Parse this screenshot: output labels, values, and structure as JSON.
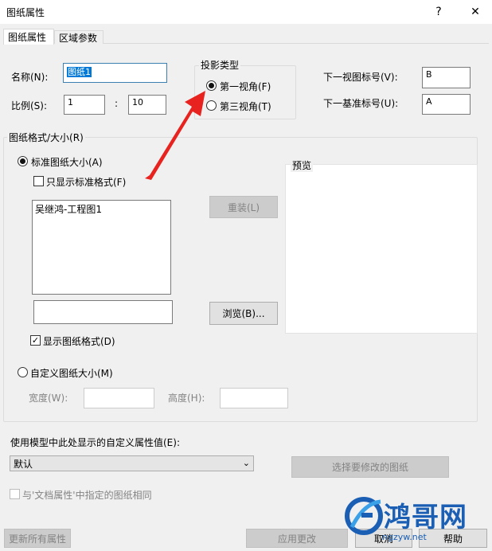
{
  "window": {
    "title": "图纸属性",
    "help_glyph": "?",
    "close_glyph": "✕"
  },
  "tabs": [
    {
      "label": "图纸属性",
      "active": true
    },
    {
      "label": "区域参数",
      "active": false
    }
  ],
  "name": {
    "label": "名称(N):",
    "value": "图纸1"
  },
  "scale": {
    "label": "比例(S):",
    "left": "1",
    "separator": ":",
    "right": "10"
  },
  "projection": {
    "title": "投影类型",
    "options": [
      {
        "label": "第一视角(F)",
        "selected": true
      },
      {
        "label": "第三视角(T)",
        "selected": false
      }
    ]
  },
  "next_view_label": {
    "label": "下一视图标号(V):",
    "value": "B"
  },
  "next_datum_label": {
    "label": "下一基准标号(U):",
    "value": "A"
  },
  "sheet_format": {
    "title": "图纸格式/大小(R)",
    "standard_label": "标准图纸大小(A)",
    "standard_selected": true,
    "only_standard_label": "只显示标准格式(F)",
    "only_standard_checked": false,
    "list_items": [
      "吴继鸿-工程图1"
    ],
    "path_value": "",
    "reload_button": "重装(L)",
    "browse_button": "浏览(B)...",
    "show_format_label": "显示图纸格式(D)",
    "show_format_checked": true,
    "custom_label": "自定义图纸大小(M)",
    "custom_selected": false,
    "width_label": "宽度(W):",
    "height_label": "高度(H):",
    "preview_title": "预览"
  },
  "custom_props": {
    "label": "使用模型中此处显示的自定义属性值(E):",
    "combo_value": "默认",
    "select_button": "选择要修改的图纸",
    "same_as_doc_label": "与'文档属性'中指定的图纸相同"
  },
  "bottom": {
    "update_all": "更新所有属性",
    "apply": "应用更改",
    "cancel": "取消",
    "help": "帮助"
  },
  "watermark": {
    "text": "鸿哥网",
    "url": "ngzyw.net"
  },
  "colors": {
    "selection": "#0078d7",
    "arrow": "#e8231f",
    "watermark": "#1a5fb4"
  }
}
